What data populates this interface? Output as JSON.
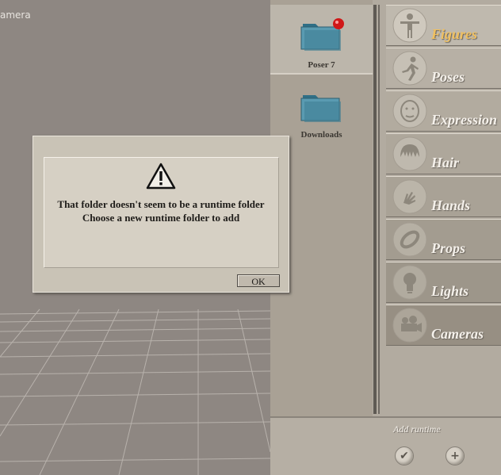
{
  "viewport": {
    "camera_label": "amera"
  },
  "folders": [
    {
      "label": "Poser 7",
      "selected": true
    },
    {
      "label": "Downloads",
      "selected": false
    }
  ],
  "categories": [
    {
      "label": "Figures",
      "icon": "figure-icon",
      "active": true
    },
    {
      "label": "Poses",
      "icon": "pose-runner-icon",
      "active": false
    },
    {
      "label": "Expression",
      "icon": "face-icon",
      "active": false
    },
    {
      "label": "Hair",
      "icon": "hair-icon",
      "active": false
    },
    {
      "label": "Hands",
      "icon": "hand-icon",
      "active": false
    },
    {
      "label": "Props",
      "icon": "prop-ring-icon",
      "active": false
    },
    {
      "label": "Lights",
      "icon": "lightbulb-icon",
      "active": false
    },
    {
      "label": "Cameras",
      "icon": "camera-icon",
      "active": false
    }
  ],
  "bottom": {
    "add_runtime_label": "Add runtime",
    "check_icon": "checkmark-icon",
    "plus_icon": "plus-icon"
  },
  "dialog": {
    "icon": "warning-triangle-icon",
    "message_line1": "That folder doesn't seem to be a runtime folder",
    "message_line2": "Choose a new runtime folder to add",
    "ok_label": "OK"
  },
  "colors": {
    "active_category": "#f0c060",
    "category_text": "#f4f0ea",
    "dialog_bg": "#c9c3b6",
    "viewport_bg": "#8e8782"
  }
}
